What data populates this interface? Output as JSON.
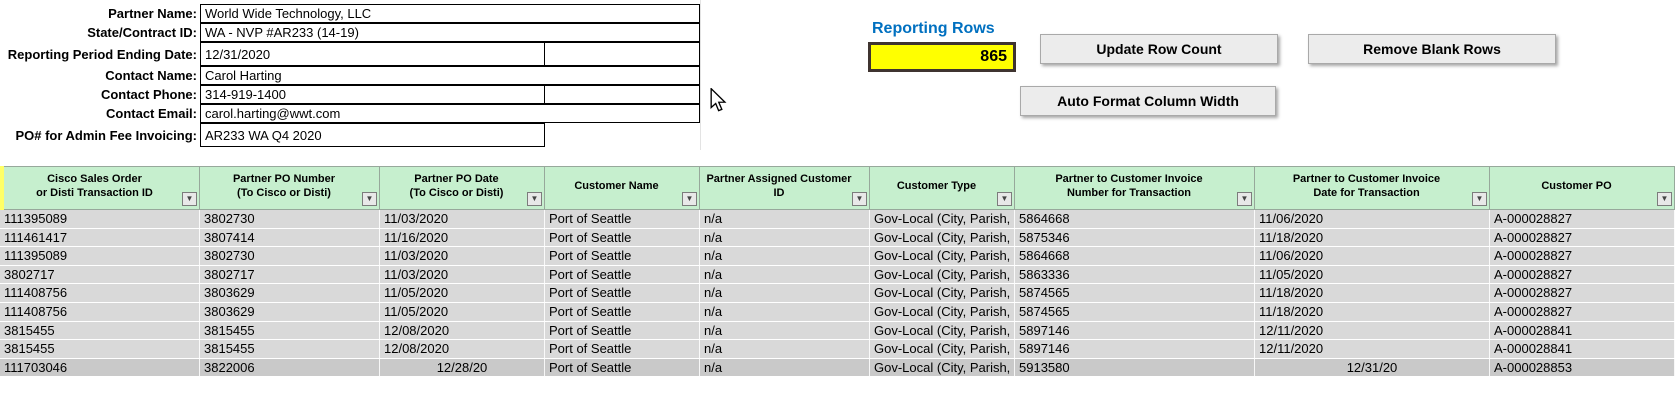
{
  "form": {
    "fields": [
      {
        "label": "Partner Name:",
        "value": "World Wide Technology, LLC"
      },
      {
        "label": "State/Contract ID:",
        "value": "WA - NVP #AR233 (14-19)"
      },
      {
        "label": "Reporting Period Ending Date:",
        "value": "12/31/2020"
      },
      {
        "label": "Contact Name:",
        "value": "Carol Harting"
      },
      {
        "label": "Contact Phone:",
        "value": "314-919-1400"
      },
      {
        "label": "Contact Email:",
        "value": "carol.harting@wwt.com"
      },
      {
        "label": "PO#  for Admin Fee Invoicing:",
        "value": "AR233 WA Q4 2020"
      }
    ]
  },
  "reporting": {
    "label": "Reporting Rows",
    "count": "865",
    "label_color": "#0070C0",
    "count_bg": "#FFFF00"
  },
  "buttons": {
    "update": "Update Row Count",
    "remove": "Remove Blank Rows",
    "autofit": "Auto Format Column Width"
  },
  "table": {
    "header_bg": "#C6EFCE",
    "columns": [
      "Cisco Sales Order\nor Disti Transaction ID",
      "Partner PO Number\n(To Cisco or Disti)",
      "Partner PO Date\n(To Cisco or Disti)",
      "Customer Name",
      "Partner Assigned Customer\nID",
      "Customer Type",
      "Partner to Customer Invoice\nNumber for Transaction",
      "Partner to Customer Invoice\nDate for Transaction",
      "Customer PO"
    ],
    "rows": [
      [
        "111395089",
        "3802730",
        "11/03/2020",
        "Port of Seattle",
        "n/a",
        "Gov-Local (City, Parish,",
        "5864668",
        "11/06/2020",
        "A-000028827"
      ],
      [
        "111461417",
        "3807414",
        "11/16/2020",
        "Port of Seattle",
        "n/a",
        "Gov-Local (City, Parish,",
        "5875346",
        "11/18/2020",
        "A-000028827"
      ],
      [
        "111395089",
        "3802730",
        "11/03/2020",
        "Port of Seattle",
        "n/a",
        "Gov-Local (City, Parish,",
        "5864668",
        "11/06/2020",
        "A-000028827"
      ],
      [
        "3802717",
        "3802717",
        "11/03/2020",
        "Port of Seattle",
        "n/a",
        "Gov-Local (City, Parish,",
        "5863336",
        "11/05/2020",
        "A-000028827"
      ],
      [
        "111408756",
        "3803629",
        "11/05/2020",
        "Port of Seattle",
        "n/a",
        "Gov-Local (City, Parish,",
        "5874565",
        "11/18/2020",
        "A-000028827"
      ],
      [
        "111408756",
        "3803629",
        "11/05/2020",
        "Port of Seattle",
        "n/a",
        "Gov-Local (City, Parish,",
        "5874565",
        "11/18/2020",
        "A-000028827"
      ],
      [
        "3815455",
        "3815455",
        "12/08/2020",
        "Port of Seattle",
        "n/a",
        "Gov-Local (City, Parish,",
        "5897146",
        "12/11/2020",
        "A-000028841"
      ],
      [
        "3815455",
        "3815455",
        "12/08/2020",
        "Port of Seattle",
        "n/a",
        "Gov-Local (City, Parish,",
        "5897146",
        "12/11/2020",
        "A-000028841"
      ],
      [
        "111703046",
        "3822006",
        "12/28/20",
        "Port of Seattle",
        "n/a",
        "Gov-Local (City, Parish,",
        "5913580",
        "12/31/20",
        "A-000028853"
      ]
    ]
  }
}
